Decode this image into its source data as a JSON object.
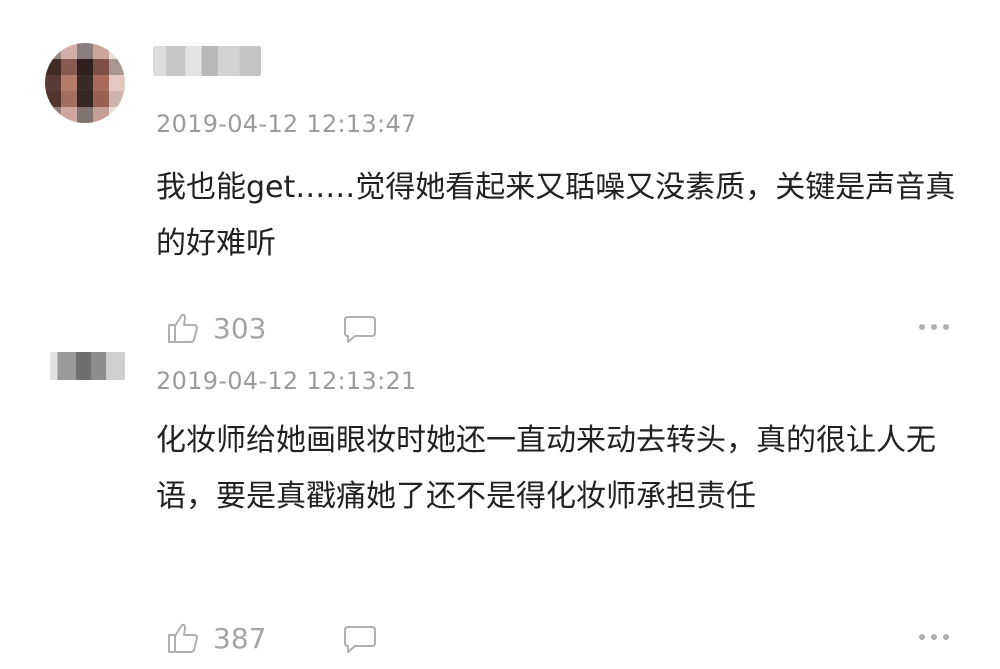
{
  "comments": [
    {
      "timestamp": "2019-04-12 12:13:47",
      "text": "我也能get……觉得她看起来又聒噪又没素质，关键是声音真的好难听",
      "likes": "303"
    },
    {
      "timestamp": "2019-04-12 12:13:21",
      "text": "化妆师给她画眼妆时她还一直动来动去转头，真的很让人无语，要是真戳痛她了还不是得化妆师承担责任",
      "likes": "387"
    }
  ],
  "icons": {
    "like": "thumbs-up-icon",
    "reply": "comment-bubble-icon",
    "more": "more-dots-icon"
  },
  "colors": {
    "text": "#222222",
    "meta": "#9b9b9b",
    "icon": "#b0b0b0"
  }
}
